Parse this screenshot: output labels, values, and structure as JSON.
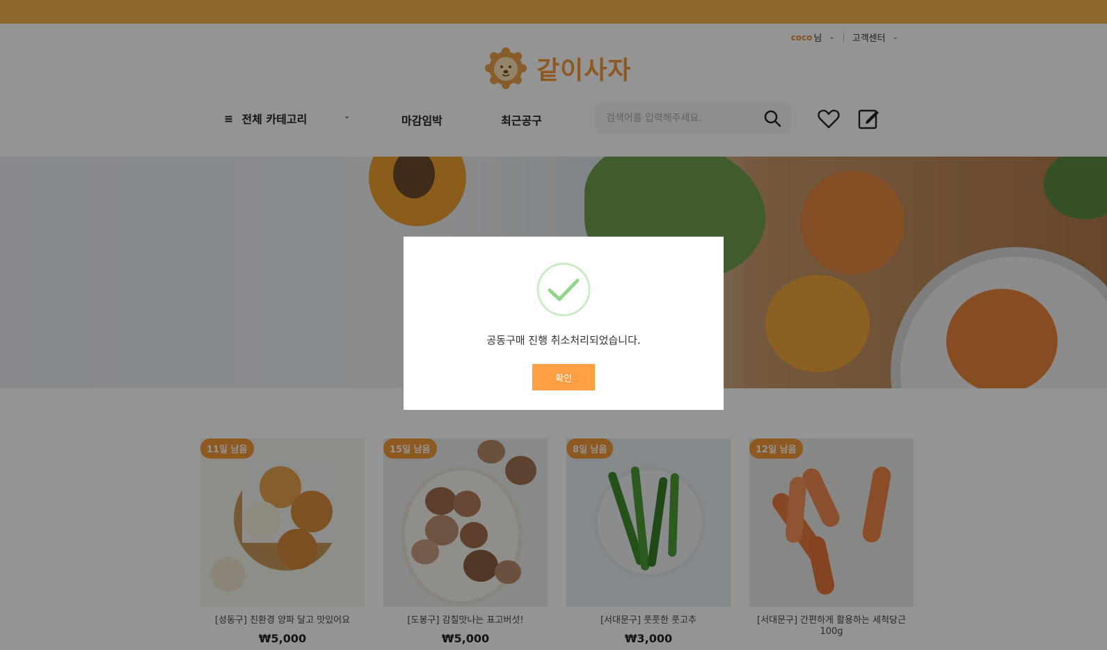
{
  "header": {
    "user_name": "coco",
    "user_suffix": "님",
    "customer_center": "고객센터",
    "brand": "같이사자",
    "search_placeholder": "검색어를 입력해주세요."
  },
  "nav": {
    "category_label": "전체 카테고리",
    "links": [
      "마감임박",
      "최근공구"
    ]
  },
  "products": [
    {
      "badge": "11일 남음",
      "title": "[성동구] 친환경 양파 달고 맛있어요",
      "price": "₩5,000",
      "theme": "onion"
    },
    {
      "badge": "15일 남음",
      "title": "[도봉구] 감칠맛나는 표고버섯!",
      "price": "₩5,000",
      "theme": "mushroom"
    },
    {
      "badge": "8일 남음",
      "title": "[서대문구] 풋풋한 풋고추",
      "price": "₩3,000",
      "theme": "pepper"
    },
    {
      "badge": "12일 남음",
      "title": "[서대문구] 간편하게 활용하는 세척당근 100g",
      "price": "",
      "theme": "carrot"
    }
  ],
  "modal": {
    "message": "공동구매 진행 취소처리되었습니다.",
    "confirm_label": "확인"
  },
  "colors": {
    "accent": "#f39a3a",
    "button": "#ff9f43",
    "topbar": "#f0b44c",
    "check": "#8fd68a"
  }
}
